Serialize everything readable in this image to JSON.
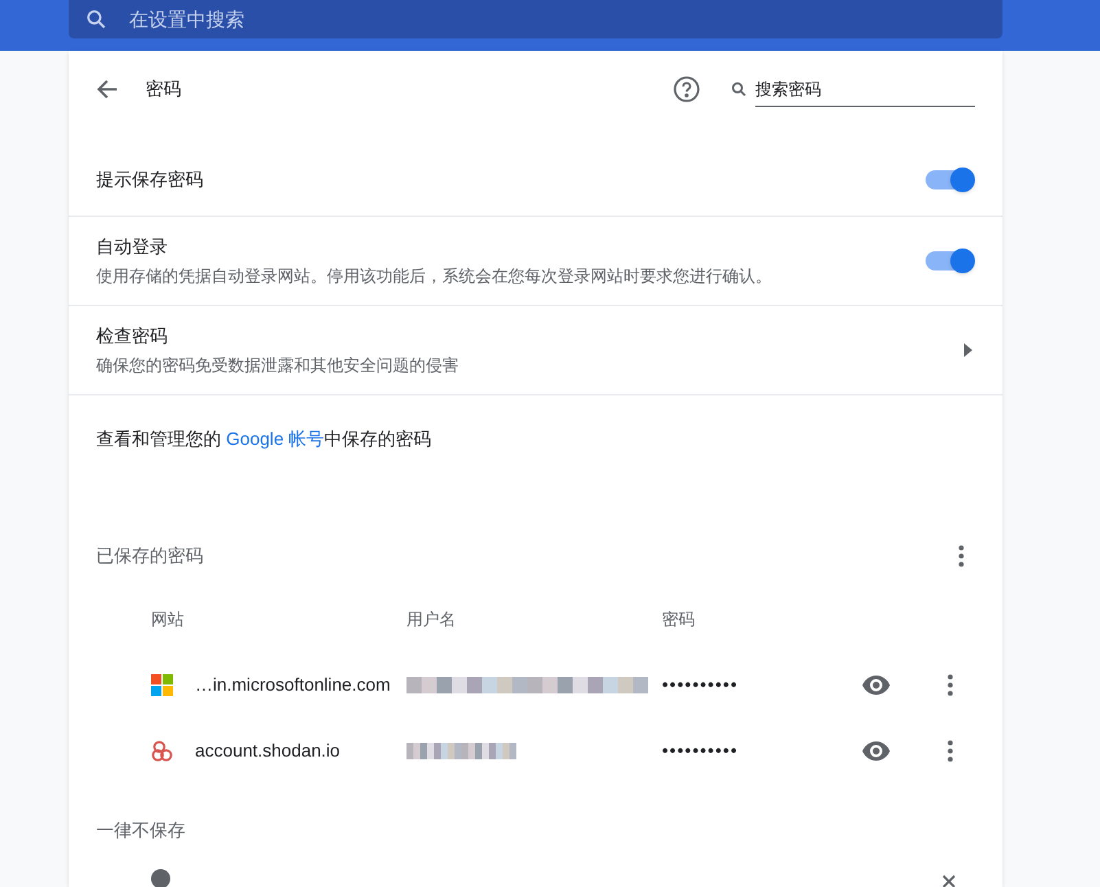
{
  "top_search": {
    "placeholder": "在设置中搜索"
  },
  "header": {
    "title": "密码",
    "search": {
      "placeholder": "搜索密码"
    }
  },
  "settings": [
    {
      "kind": "toggle",
      "title": "提示保存密码",
      "on": true
    },
    {
      "kind": "toggle",
      "title": "自动登录",
      "description": "使用存储的凭据自动登录网站。停用该功能后，系统会在您每次登录网站时要求您进行确认。",
      "on": true
    },
    {
      "kind": "link",
      "title": "检查密码",
      "description": "确保您的密码免受数据泄露和其他安全问题的侵害"
    }
  ],
  "account_note": {
    "before": "查看和管理您的 ",
    "link": "Google 帐号",
    "after": "中保存的密码"
  },
  "saved": {
    "title": "已保存的密码",
    "columns": [
      "网站",
      "用户名",
      "密码"
    ],
    "rows": [
      {
        "kind": "windows",
        "site": "…in.microsoftonline.com",
        "password": "••••••••••"
      },
      {
        "kind": "rings",
        "site": "account.shodan.io",
        "password": "••••••••••"
      }
    ]
  },
  "never_saved": {
    "title": "一律不保存"
  }
}
